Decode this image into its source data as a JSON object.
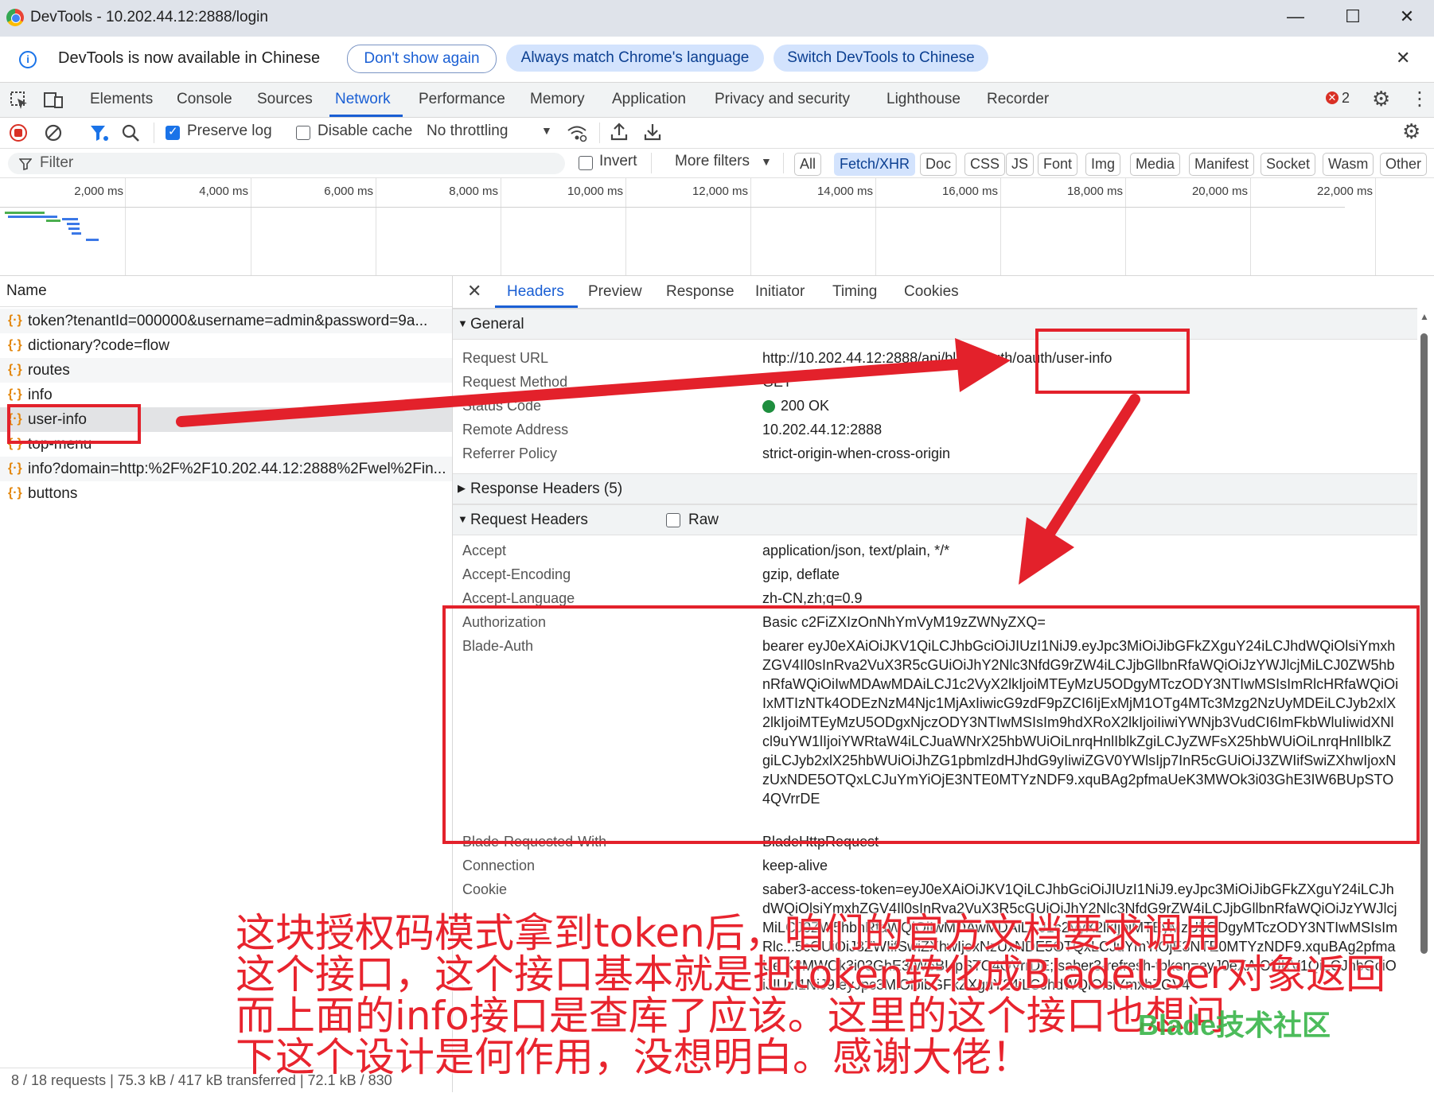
{
  "window": {
    "title": "DevTools - 10.202.44.12:2888/login",
    "controls": [
      "—",
      "☐",
      "✕"
    ]
  },
  "infobar": {
    "message": "DevTools is now available in Chinese",
    "btn_dont_show": "Don't show again",
    "btn_match_lang": "Always match Chrome's language",
    "btn_switch": "Switch DevTools to Chinese",
    "close": "✕"
  },
  "tabs": [
    "Elements",
    "Console",
    "Sources",
    "Network",
    "Performance",
    "Memory",
    "Application",
    "Privacy and security",
    "Lighthouse",
    "Recorder"
  ],
  "active_tab": "Network",
  "issues_count": "2",
  "toolbar": {
    "preserve_log": "Preserve log",
    "preserve_log_checked": true,
    "disable_cache": "Disable cache",
    "disable_cache_checked": false,
    "throttling": "No throttling"
  },
  "filterbar": {
    "placeholder": "Filter",
    "invert": "Invert",
    "more_filters": "More filters",
    "chips": [
      "All",
      "Fetch/XHR",
      "Doc",
      "CSS",
      "JS",
      "Font",
      "Img",
      "Media",
      "Manifest",
      "Socket",
      "Wasm",
      "Other"
    ],
    "active_chip": "Fetch/XHR"
  },
  "overview": {
    "ticks": [
      "2,000 ms",
      "4,000 ms",
      "6,000 ms",
      "8,000 ms",
      "10,000 ms",
      "12,000 ms",
      "14,000 ms",
      "16,000 ms",
      "18,000 ms",
      "20,000 ms",
      "22,000 ms"
    ]
  },
  "requests": {
    "header": "Name",
    "items": [
      "token?tenantId=000000&username=admin&password=9a...",
      "dictionary?code=flow",
      "routes",
      "info",
      "user-info",
      "top-menu",
      "info?domain=http:%2F%2F10.202.44.12:2888%2Fwel%2Fin...",
      "buttons"
    ],
    "selected": "user-info",
    "status": "8 / 18 requests  |  75.3 kB / 417 kB transferred  |  72.1 kB / 830"
  },
  "detail": {
    "close": "✕",
    "tabs": [
      "Headers",
      "Preview",
      "Response",
      "Initiator",
      "Timing",
      "Cookies"
    ],
    "active_tab": "Headers",
    "general_title": "General",
    "general": [
      {
        "k": "Request URL",
        "v": "http://10.202.44.12:2888/api/blade-auth/oauth/user-info"
      },
      {
        "k": "Request Method",
        "v": "GET"
      },
      {
        "k": "Status Code",
        "v": "200 OK"
      },
      {
        "k": "Remote Address",
        "v": "10.202.44.12:2888"
      },
      {
        "k": "Referrer Policy",
        "v": "strict-origin-when-cross-origin"
      }
    ],
    "response_headers_title": "Response Headers (5)",
    "request_headers_title": "Request Headers",
    "raw_label": "Raw",
    "request_headers": [
      {
        "k": "Accept",
        "v": "application/json, text/plain, */*"
      },
      {
        "k": "Accept-Encoding",
        "v": "gzip, deflate"
      },
      {
        "k": "Accept-Language",
        "v": "zh-CN,zh;q=0.9"
      },
      {
        "k": "Authorization",
        "v": "Basic c2FiZXIzOnNhYmVyM19zZWNyZXQ="
      }
    ],
    "blade_auth_key": "Blade-Auth",
    "blade_auth_value": "bearer eyJ0eXAiOiJKV1QiLCJhbGciOiJIUzI1NiJ9.eyJpc3MiOiJibGFkZXguY24iLCJhdWQiOlsiYmxhZGV4Il0sInRva2VuX3R5cGUiOiJhY2Nlc3NfdG9rZW4iLCJjbGllbnRfaWQiOiJzYWJlcjMiLCJ0ZW5hbnRfaWQiOiIwMDAwMDAiLCJ1c2VyX2lkIjoiMTEyMzU5ODgyMTczODY3NTIwMSIsImRlcHRfaWQiOiIxMTIzNTk4ODEzNzM4Njc1MjAxIiwicG9zdF9pZCI6IjExMjM1OTg4MTc3Mzg2NzUyMDEiLCJyb2xlX2lkIjoiMTEyMzU5ODgxNjczODY3NTIwMSIsIm9hdXRoX2lkIjoiIiwiYWNjb3VudCI6ImFkbWluIiwidXNlcl9uYW1lIjoiYWRtaW4iLCJuaWNrX25hbWUiOiLnrqHnlIblkZgiLCJyZWFsX25hbWUiOiLnrqHnlIblkZgiLCJyb2xlX25hbWUiOiJhZG1pbmlzdHJhdG9yIiwiZGV0YWlsIjp7InR5cGUiOiJ3ZWIifSwiZXhwIjoxNzUxNDE5OTQxLCJuYmYiOjE3NTE0MTYzNDF9.xquBAg2pfmaUeK3MWOk3i03GhE3IW6BUpSTO4QVrrDE",
    "more_headers": [
      {
        "k": "Blade-Requested-With",
        "v": "BladeHttpRequest"
      },
      {
        "k": "Connection",
        "v": "keep-alive"
      }
    ],
    "cookie_key": "Cookie",
    "cookie_value": "saber3-access-token=eyJ0eXAiOiJKV1QiLCJhbGciOiJIUzI1NiJ9.eyJpc3MiOiJibGFkZXguY24iLCJhdWQiOlsiYmxhZGV4Il0sInRva2VuX3R5cGUiOiJhY2Nlc3NfdG9rZW4iLCJjbGllbnRfaWQiOiJzYWJlcjMiLCJ0ZW5hbnRfaWQiOiIwMDAwMDAiLCJ1c2VyX2lkIjoiMTEyMzU5ODgyMTczODY3NTIwMSIsImRlc...5cGUiOiJ3ZWIifSwiZXhwIjoxNzUxNDE5OTQxLCJuYmYiOjE3NTE0MTYzNDF9.xquBAg2pfmaUe K3MWOk3i03GhE3IW6BUpSTO4QVrrDE; saber3-refresh-token=eyJ0eXAiOiJKV1QiLCJhbGciOiJIUzI1NiJ9.eyJpc3MiOiJibGFkZXguY24iLCJhdWQiOlsiYmxhZGV4"
  },
  "annotation": {
    "line1": "这块授权码模式拿到token后，咱们的官方文档要求调用",
    "line2": "这个接口，这个接口基本就是把token转化成BladeUser对象返回",
    "line3": "而上面的info接口是查库了应该。这里的这个接口也想问",
    "line4": "下这个设计是何作用，没想明白。感谢大佬！",
    "watermark": "Blade技术社区"
  },
  "colors": {
    "accent": "#1a5fd4",
    "annotation_red": "#e3212b",
    "status_green": "#1e8e3e"
  }
}
